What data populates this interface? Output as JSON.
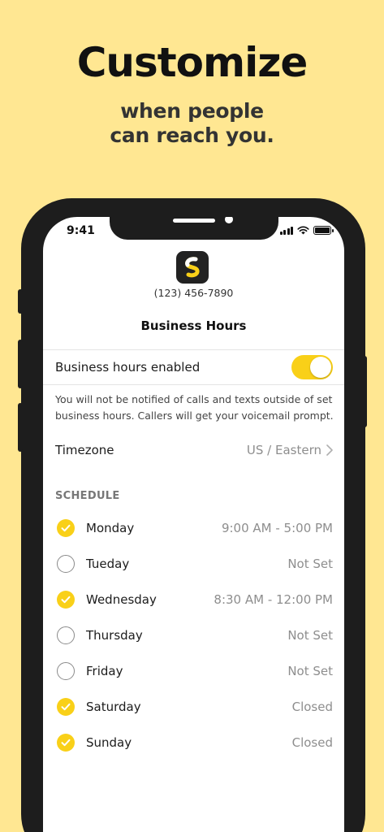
{
  "headline": "Customize",
  "subheadline": [
    "when people",
    "can reach you."
  ],
  "status_bar": {
    "time": "9:41"
  },
  "phone_number": "(123) 456-7890",
  "page_title": "Business Hours",
  "business_hours": {
    "label": "Business hours enabled",
    "enabled": true
  },
  "notice": "You will not be notified of calls and texts outside of set business hours. Callers will get your voicemail prompt.",
  "timezone": {
    "label": "Timezone",
    "value": "US / Eastern"
  },
  "schedule_header": "SCHEDULE",
  "schedule": [
    {
      "day": "Monday",
      "hours": "9:00 AM - 5:00 PM",
      "checked": true
    },
    {
      "day": "Tueday",
      "hours": "Not Set",
      "checked": false
    },
    {
      "day": "Wednesday",
      "hours": "8:30 AM - 12:00 PM",
      "checked": true
    },
    {
      "day": "Thursday",
      "hours": "Not Set",
      "checked": false
    },
    {
      "day": "Friday",
      "hours": "Not Set",
      "checked": false
    },
    {
      "day": "Saturday",
      "hours": "Closed",
      "checked": true
    },
    {
      "day": "Sunday",
      "hours": "Closed",
      "checked": true
    }
  ],
  "colors": {
    "background": "#FFE792",
    "accent": "#F9D018",
    "phone_frame": "#1d1d1d"
  },
  "icons": [
    "app-logo-icon",
    "signal-icon",
    "wifi-icon",
    "battery-icon",
    "chevron-right-icon",
    "checkmark-icon"
  ]
}
